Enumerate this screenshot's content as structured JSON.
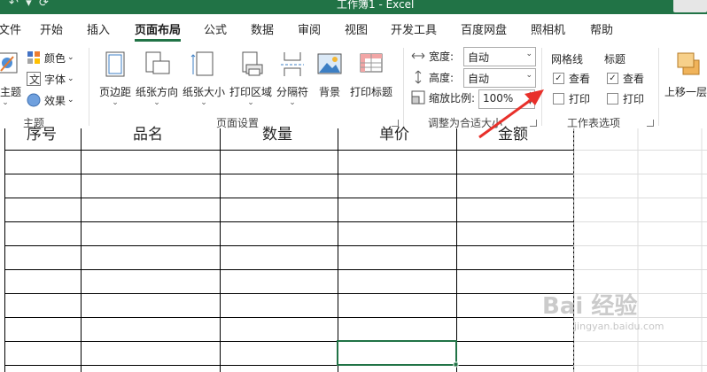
{
  "window": {
    "title": "工作簿1 - Excel"
  },
  "tabs": [
    "文件",
    "开始",
    "插入",
    "页面布局",
    "公式",
    "数据",
    "审阅",
    "视图",
    "开发工具",
    "百度网盘",
    "照相机",
    "帮助"
  ],
  "active_tab": "页面布局",
  "ribbon": {
    "theme": {
      "themes_label": "主题",
      "colors_label": "颜色",
      "fonts_label": "字体",
      "effects_label": "效果",
      "group_label": "主题"
    },
    "page_setup": {
      "margins_label": "页边距",
      "orientation_label": "纸张方向",
      "size_label": "纸张大小",
      "print_area_label": "打印区域",
      "breaks_label": "分隔符",
      "background_label": "背景",
      "print_titles_label": "打印标题",
      "group_label": "页面设置"
    },
    "scale_to_fit": {
      "width_label": "宽度:",
      "width_value": "自动",
      "height_label": "高度:",
      "height_value": "自动",
      "scale_label": "缩放比例:",
      "scale_value": "100%",
      "group_label": "调整为合适大小"
    },
    "sheet_options": {
      "gridlines_label": "网格线",
      "headings_label": "标题",
      "view_label": "查看",
      "print_label": "打印",
      "gridlines_view": true,
      "gridlines_print": false,
      "headings_view": true,
      "headings_print": false,
      "group_label": "工作表选项"
    },
    "arrange": {
      "bring_forward_label": "上移一层"
    }
  },
  "sheet": {
    "header_row": [
      "序号",
      "品名",
      "数量",
      "单价",
      "金额"
    ]
  },
  "watermark": {
    "text": "Bai 经验",
    "subtext": "jingyan.baidu.com"
  },
  "colors": {
    "excel_green": "#217346",
    "arrow_red": "#e8302a"
  }
}
